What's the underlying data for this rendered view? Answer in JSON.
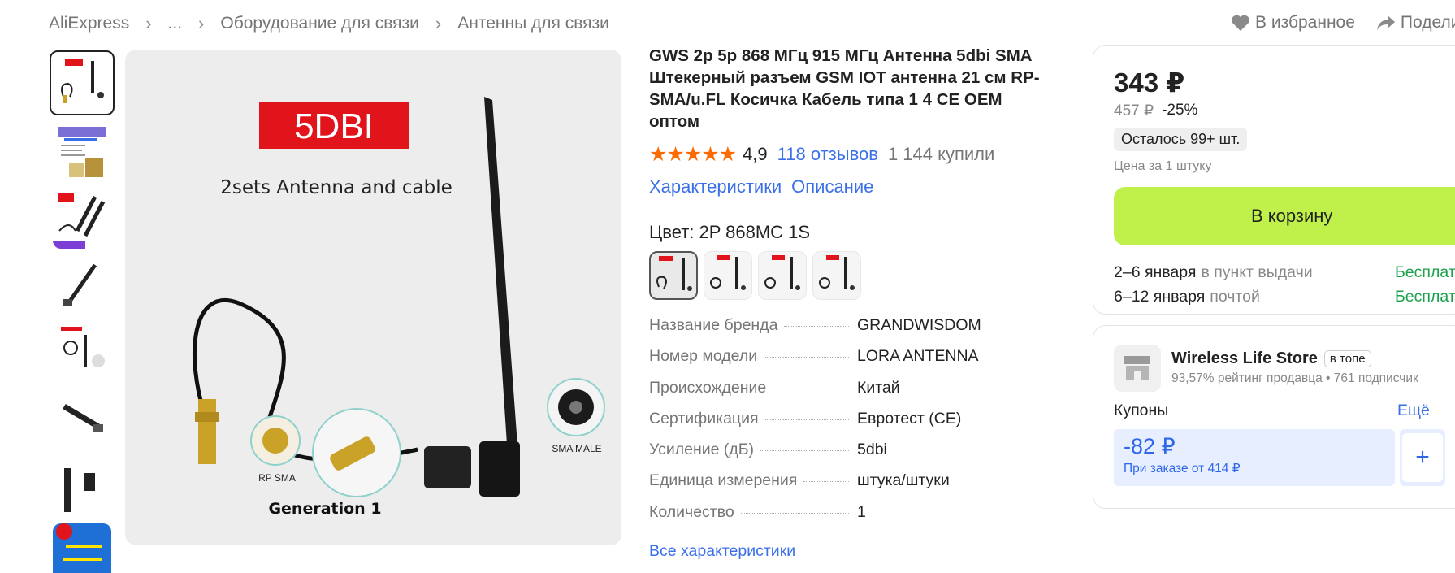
{
  "breadcrumb": {
    "items": [
      "AliExpress",
      "...",
      "Оборудование для связи",
      "Антенны для связи"
    ]
  },
  "top_actions": {
    "favorite": "В избранное",
    "share": "Подели"
  },
  "product": {
    "title": "GWS 2p 5p 868 МГц 915 МГц Антенна 5dbi SMA Штекерный разъем GSM IOT антенна 21 см RP-SMA/u.FL Косичка Кабель типа 1 4 CE OEM оптом",
    "stars": "★★★★★",
    "rating": "4,9",
    "reviews": "118 отзывов",
    "bought": "1 144 купили",
    "link_specs": "Характеристики",
    "link_description": "Описание",
    "color_label": "Цвет: 2P 868MC 1S",
    "specs": [
      {
        "k": "Название бренда",
        "v": "GRANDWISDOM"
      },
      {
        "k": "Номер модели",
        "v": "LORA ANTENNA"
      },
      {
        "k": "Происхождение",
        "v": "Китай"
      },
      {
        "k": "Сертификация",
        "v": "Евротест (CE)"
      },
      {
        "k": "Усиление (дБ)",
        "v": "5dbi"
      },
      {
        "k": "Единица измерения",
        "v": "штука/штуки"
      },
      {
        "k": "Количество",
        "v": "1"
      }
    ],
    "all_specs": "Все характеристики"
  },
  "image": {
    "badge": "5DBI",
    "headline": "2sets Antenna and cable",
    "label_rp": "RP SMA",
    "label_sma": "SMA MALE",
    "caption": "Generation 1"
  },
  "buy": {
    "price": "343 ₽",
    "old_price": "457 ₽",
    "discount": "-25%",
    "stock": "Осталось 99+ шт.",
    "per_unit": "Цена за 1 штуку",
    "cart": "В корзину",
    "delivery": [
      {
        "date": "2–6 января",
        "method": "в пункт выдачи",
        "price": "Бесплат"
      },
      {
        "date": "6–12 января",
        "method": "почтой",
        "price": "Бесплат"
      }
    ]
  },
  "store": {
    "name": "Wireless Life Store",
    "badge": "в топе",
    "meta": "93,57% рейтинг продавца  •  761 подписчик",
    "coupons_label": "Купоны",
    "more": "Ещё",
    "coupon_amount": "-82 ₽",
    "coupon_condition": "При заказе от 414 ₽",
    "coupon_add": "+"
  },
  "colors": {
    "accent_blue": "#3a6fea",
    "cart_green": "#bff14a",
    "star_orange": "#fd6a00",
    "free_green": "#1aa24a",
    "badge_red": "#e1141b"
  }
}
